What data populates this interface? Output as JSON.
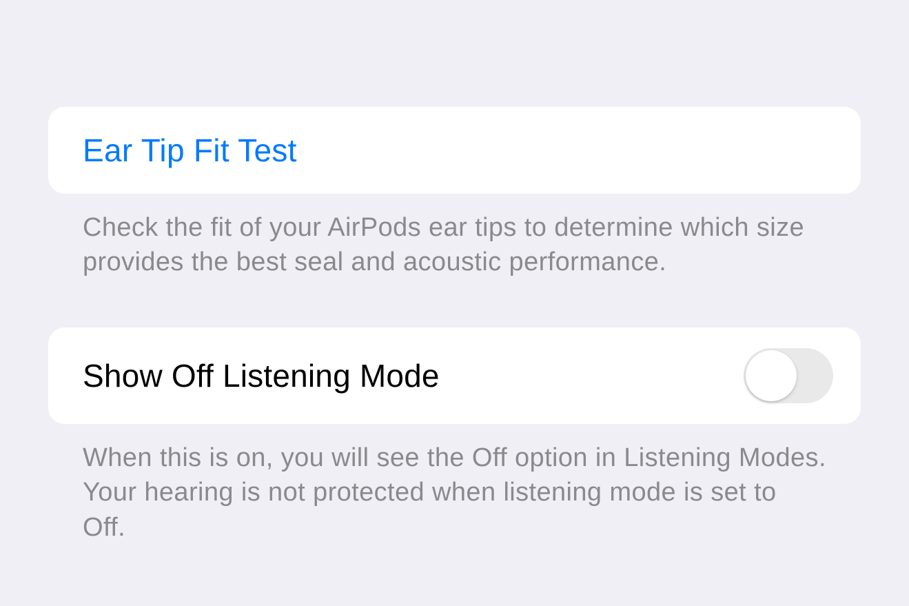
{
  "sections": {
    "earTipFitTest": {
      "label": "Ear Tip Fit Test",
      "footer": "Check the fit of your AirPods ear tips to determine which size provides the best seal and acoustic performance."
    },
    "showOffListening": {
      "label": "Show Off Listening Mode",
      "toggleState": "off",
      "footer": "When this is on, you will see the Off option in Listening Modes. Your hearing is not protected when listening mode is set to Off."
    }
  }
}
